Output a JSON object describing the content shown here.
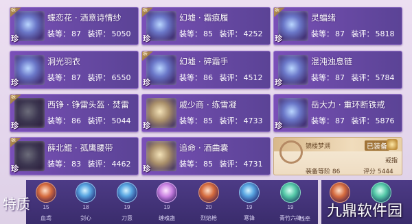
{
  "labels": {
    "corner_tag": "装",
    "rare_tag": "珍",
    "req_label": "装等：",
    "score_label": "装评："
  },
  "equipment": [
    {
      "name": "蝶恋花 · 酒意诗情纱",
      "level": "87",
      "score": "5050"
    },
    {
      "name": "幻墟 · 霜痕履",
      "level": "85",
      "score": "4252"
    },
    {
      "name": "灵蝠绪",
      "level": "87",
      "score": "5818"
    },
    {
      "name": "洞光羽衣",
      "level": "87",
      "score": "6550"
    },
    {
      "name": "幻墟 · 碎霜手",
      "level": "86",
      "score": "4512"
    },
    {
      "name": "混沌浊息链",
      "level": "87",
      "score": "5784"
    },
    {
      "name": "西铮 · 铮雷头盔 · 焚雷",
      "level": "86",
      "score": "5044"
    },
    {
      "name": "戚少商 · 练雪凝",
      "level": "85",
      "score": "4733"
    },
    {
      "name": "岳大力 · 重环断铁戒",
      "level": "87",
      "score": "5876"
    },
    {
      "name": "薛北鲲 · 孤鹰腰带",
      "level": "83",
      "score": "4462"
    },
    {
      "name": "追命 · 酒曲囊",
      "level": "85",
      "score": "4731"
    }
  ],
  "special_item": {
    "title": "镜楼梦溯",
    "equipped_label": "已装备",
    "type": "戒指",
    "req_text": "装备等阶 86",
    "score_text": "评分  5444"
  },
  "traits": {
    "title": "特质",
    "items": [
      {
        "level": "15",
        "name": "血鸢"
      },
      {
        "level": "18",
        "name": "剑心"
      },
      {
        "level": "19",
        "name": "刀意"
      },
      {
        "level": "19",
        "name": "缠魂蛊"
      },
      {
        "level": "20",
        "name": "烈焰枪"
      },
      {
        "level": "19",
        "name": "寒锋"
      },
      {
        "level": "19",
        "name": "青竹六律"
      },
      {
        "level": "",
        "name": "一线牵"
      }
    ]
  },
  "watermark": "九鼎软件园"
}
